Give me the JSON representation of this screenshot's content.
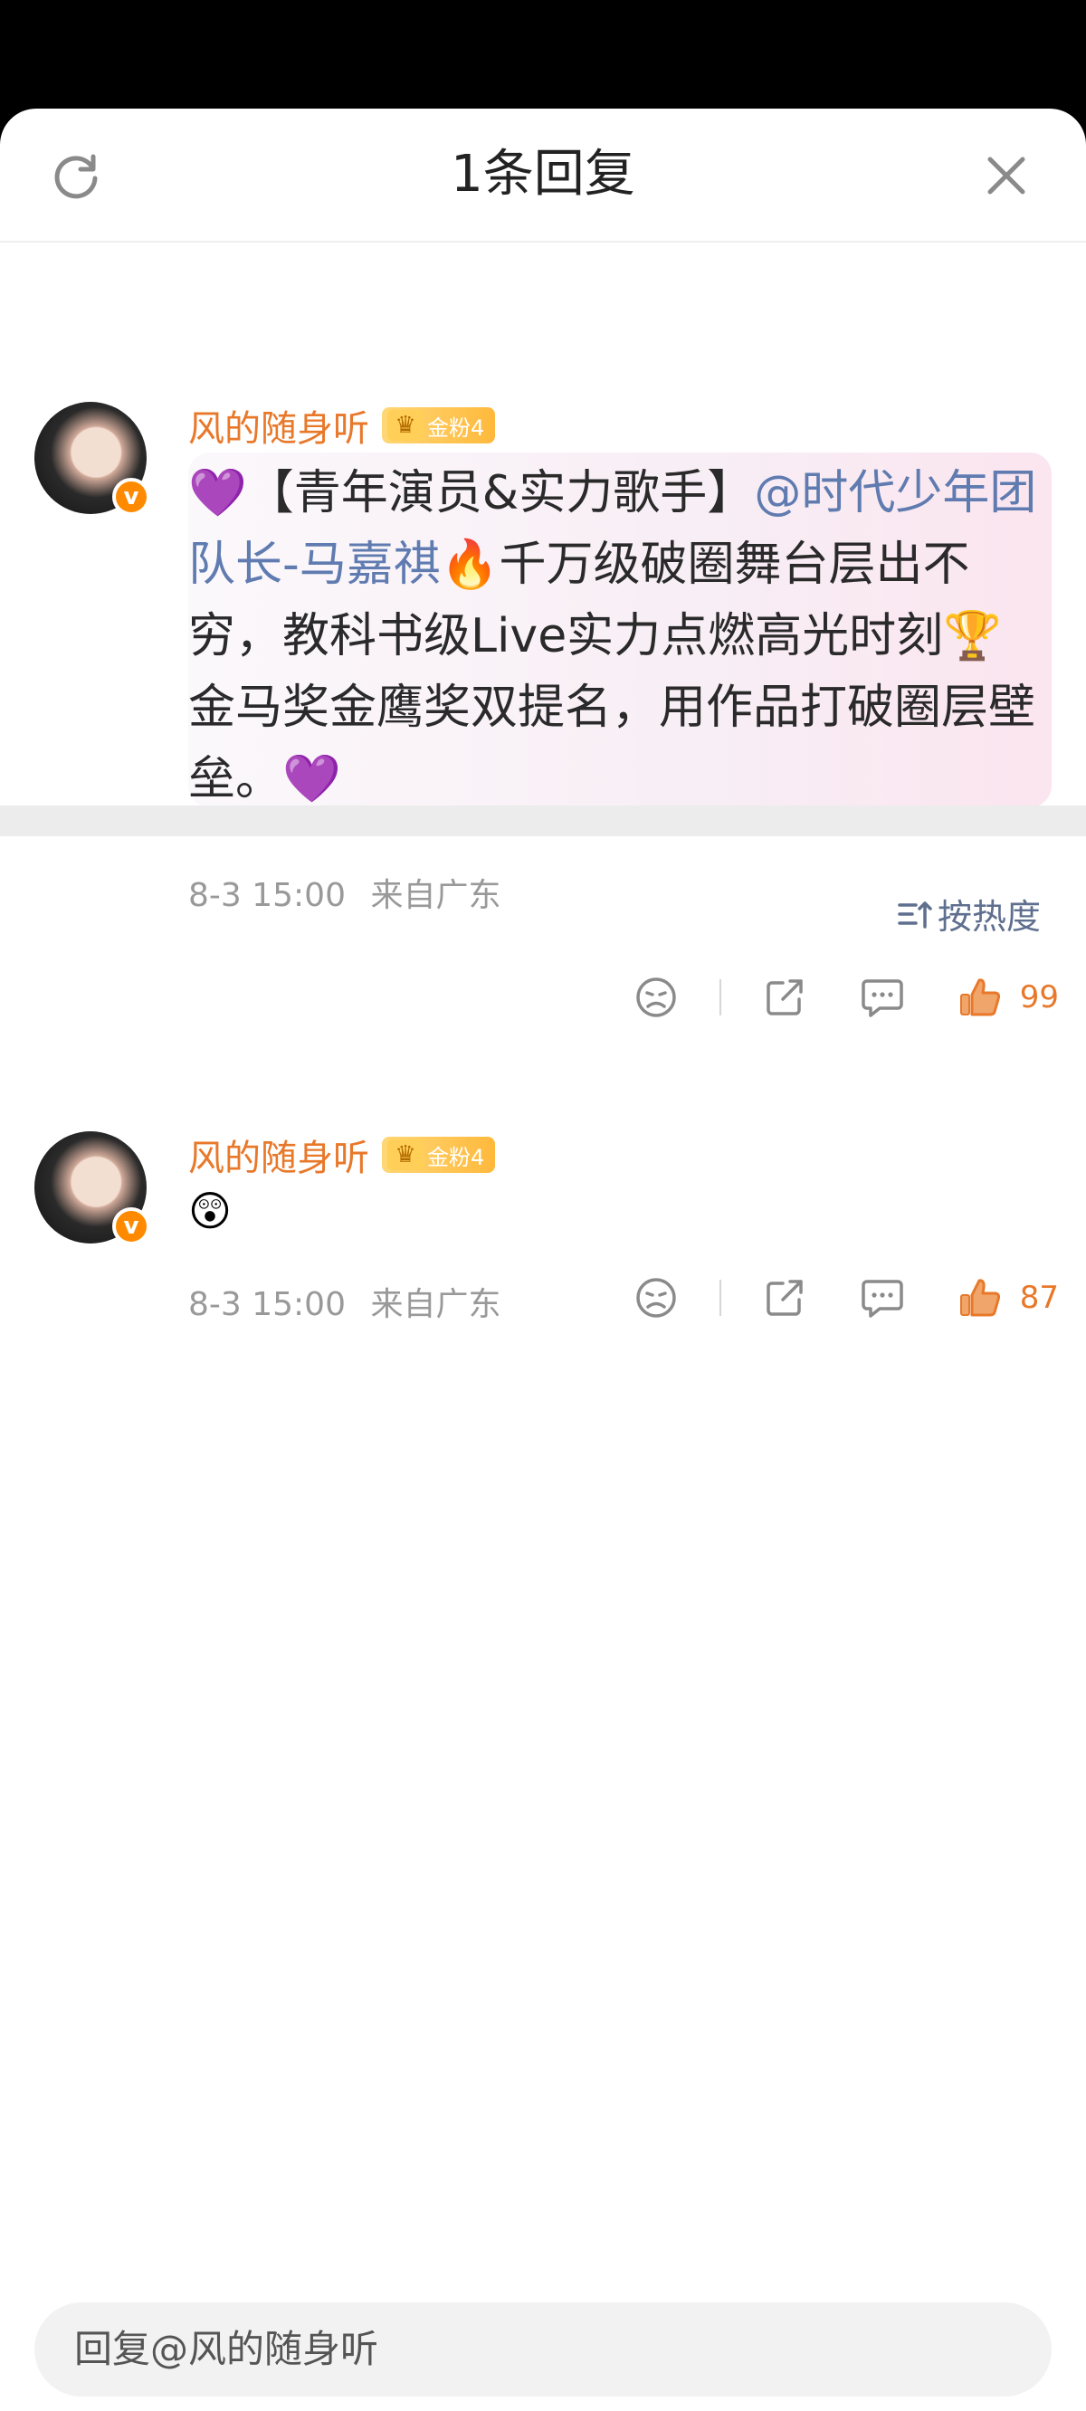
{
  "header": {
    "title": "1条回复"
  },
  "comments": [
    {
      "username": "风的随身听",
      "badge": "金粉4",
      "content_emoji_start": "💜",
      "content_part1": "【青年演员&实力歌手】",
      "mention": "@时代少年团队长-马嘉祺",
      "content_emoji_fire": "🔥",
      "content_part2": "千万级破圈舞台层出不穷，教科书级Live实力点燃高光时刻",
      "content_emoji_trophy": "🏆",
      "content_part3": "金马奖金鹰奖双提名，用作品打破圈层壁垒。",
      "content_emoji_end": "💜",
      "time": "8-3 15:00",
      "location": "来自广东",
      "likes": "99"
    },
    {
      "username": "风的随身听",
      "badge": "金粉4",
      "content": "😲",
      "time": "8-3 15:00",
      "location": "来自广东",
      "likes": "87"
    }
  ],
  "sort": {
    "label": "按热度"
  },
  "reply": {
    "placeholder": "回复@风的随身听"
  },
  "colors": {
    "accent": "#e8782a",
    "mention": "#5f7bb0",
    "meta": "#999999"
  }
}
